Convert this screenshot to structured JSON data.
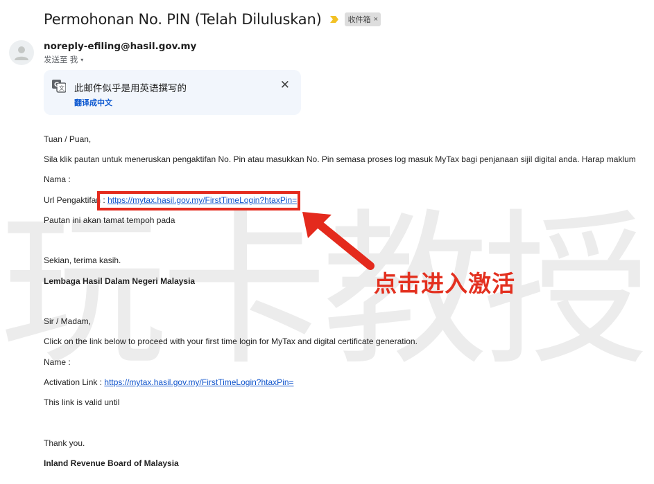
{
  "header": {
    "subject": "Permohonan No. PIN (Telah Diluluskan)",
    "label": "收件箱",
    "label_close": "×"
  },
  "sender": {
    "email": "noreply-efiling@hasil.gov.my",
    "recipient_label": "发送至 我",
    "caret": "▾"
  },
  "translate_bar": {
    "message": "此邮件似乎是用英语撰写的",
    "action": "翻译成中文",
    "close": "✕"
  },
  "email_body": {
    "ms_greeting": "Tuan / Puan,",
    "ms_instruction": "Sila klik pautan untuk meneruskan pengaktifan No. Pin atau masukkan No. Pin semasa proses log masuk MyTax bagi penjanaan sijil digital anda. Harap maklum",
    "ms_name": "Nama :",
    "ms_url_label": "Url Pengaktifan :",
    "ms_url": "https://mytax.hasil.gov.my/FirstTimeLogin?htaxPin=",
    "ms_expiry": "Pautan ini akan tamat tempoh pada",
    "ms_thanks": "Sekian, terima kasih.",
    "ms_org": "Lembaga Hasil Dalam Negeri Malaysia",
    "en_greeting": "Sir / Madam,",
    "en_instruction": "Click on the link below to proceed with your first time login for MyTax and digital certificate generation.",
    "en_name": "Name :",
    "en_link_label": "Activation Link :",
    "en_link": "https://mytax.hasil.gov.my/FirstTimeLogin?htaxPin=",
    "en_validity": "This link is valid until",
    "en_thanks": "Thank you.",
    "en_org": "Inland Revenue Board of Malaysia"
  },
  "overlay": {
    "watermark": "玩卡教授",
    "annotation": "点击进入激活",
    "accent_color": "#e42a1d"
  }
}
